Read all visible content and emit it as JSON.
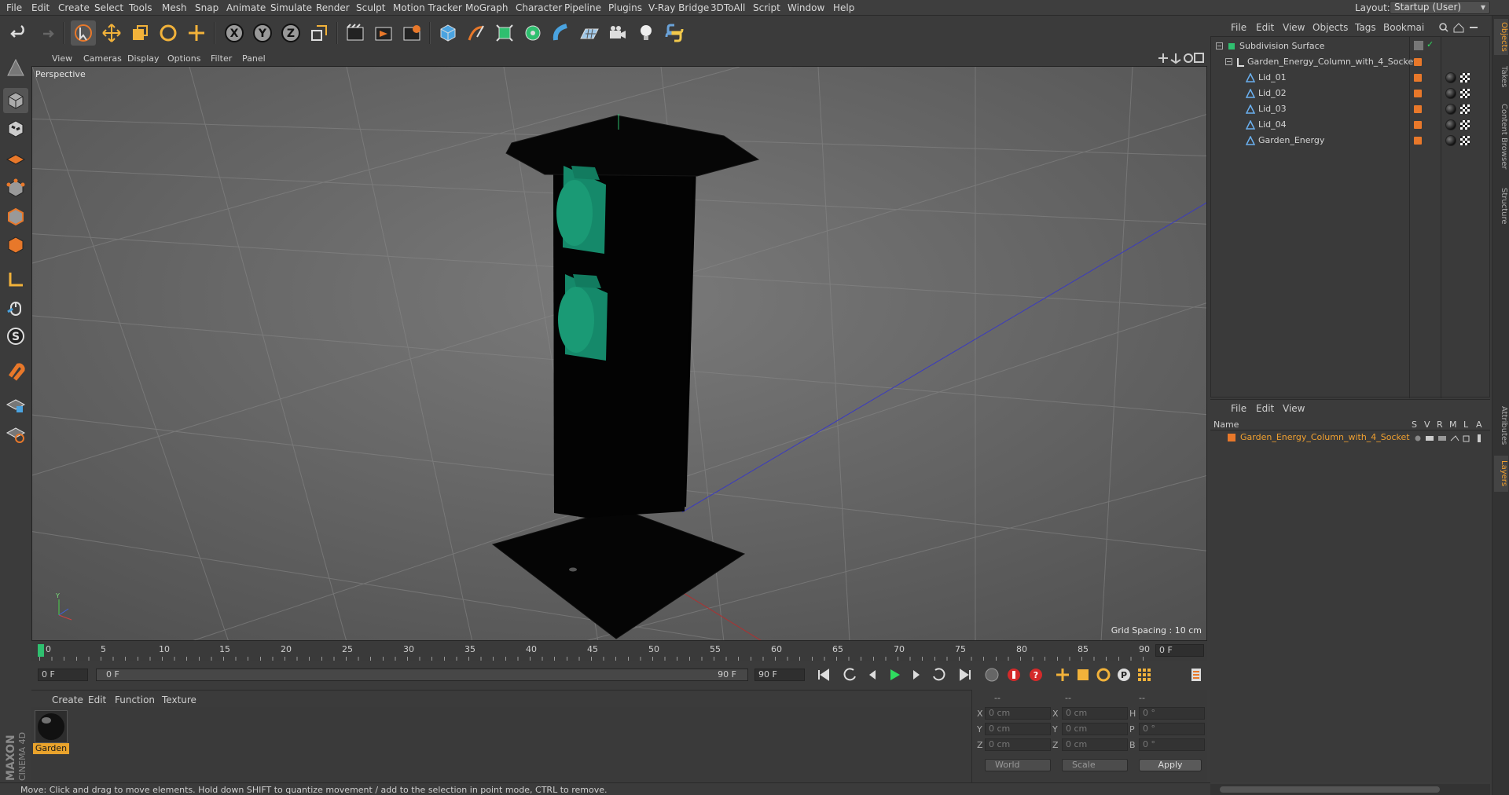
{
  "menubar": {
    "items": [
      "File",
      "Edit",
      "Create",
      "Select",
      "Tools",
      "Mesh",
      "Snap",
      "Animate",
      "Simulate",
      "Render",
      "Sculpt",
      "Motion Tracker",
      "MoGraph",
      "Character",
      "Pipeline",
      "Plugins",
      "V-Ray Bridge",
      "3DToAll",
      "Script",
      "Window",
      "Help"
    ],
    "layout_label": "Layout:",
    "layout_value": "Startup (User)"
  },
  "viewport": {
    "menu": [
      "View",
      "Cameras",
      "Display",
      "Options",
      "Filter",
      "Panel"
    ],
    "camera_label": "Perspective",
    "grid_spacing": "Grid Spacing : 10 cm"
  },
  "timeline": {
    "ticks": [
      "0",
      "5",
      "10",
      "15",
      "20",
      "25",
      "30",
      "35",
      "40",
      "45",
      "50",
      "55",
      "60",
      "65",
      "70",
      "75",
      "80",
      "85",
      "90"
    ],
    "current_frame": "0 F",
    "start_field": "0 F",
    "range_start": "0 F",
    "range_end": "90 F",
    "end_field": "90 F"
  },
  "material": {
    "menu": [
      "Create",
      "Edit",
      "Function",
      "Texture"
    ],
    "name": "Garden"
  },
  "coordinates": {
    "headers": [
      "--",
      "--",
      "--"
    ],
    "rows": [
      {
        "l1": "X",
        "v1": "0 cm",
        "l2": "X",
        "v2": "0 cm",
        "l3": "H",
        "v3": "0 °"
      },
      {
        "l1": "Y",
        "v1": "0 cm",
        "l2": "Y",
        "v2": "0 cm",
        "l3": "P",
        "v3": "0 °"
      },
      {
        "l1": "Z",
        "v1": "0 cm",
        "l2": "Z",
        "v2": "0 cm",
        "l3": "B",
        "v3": "0 °"
      }
    ],
    "mode": "World",
    "scale": "Scale",
    "apply": "Apply"
  },
  "status": "Move: Click and drag to move elements. Hold down SHIFT to quantize movement / add to the selection in point mode, CTRL to remove.",
  "brand": {
    "maxon": "MAXON",
    "product": "CINEMA 4D"
  },
  "objects": {
    "menu": [
      "File",
      "Edit",
      "View",
      "Objects",
      "Tags",
      "Bookmai"
    ],
    "items": [
      {
        "name": "Subdivision Surface",
        "indent": 0
      },
      {
        "name": "Garden_Energy_Column_with_4_Socket",
        "indent": 1
      },
      {
        "name": "Lid_01",
        "indent": 2
      },
      {
        "name": "Lid_02",
        "indent": 2
      },
      {
        "name": "Lid_03",
        "indent": 2
      },
      {
        "name": "Lid_04",
        "indent": 2
      },
      {
        "name": "Garden_Energy",
        "indent": 2
      }
    ]
  },
  "layers": {
    "menu": [
      "File",
      "Edit",
      "View"
    ],
    "headers": {
      "name": "Name",
      "s": "S",
      "v": "V",
      "r": "R",
      "m": "M",
      "l": "L",
      "a": "A"
    },
    "row": "Garden_Energy_Column_with_4_Socket"
  },
  "side_tabs": [
    "Objects",
    "Takes",
    "Content Browser",
    "Structure",
    "Attributes",
    "Layers"
  ],
  "colors": {
    "accent": "#e8782a",
    "socket": "#1a8f6a",
    "selection": "#f0a030"
  }
}
